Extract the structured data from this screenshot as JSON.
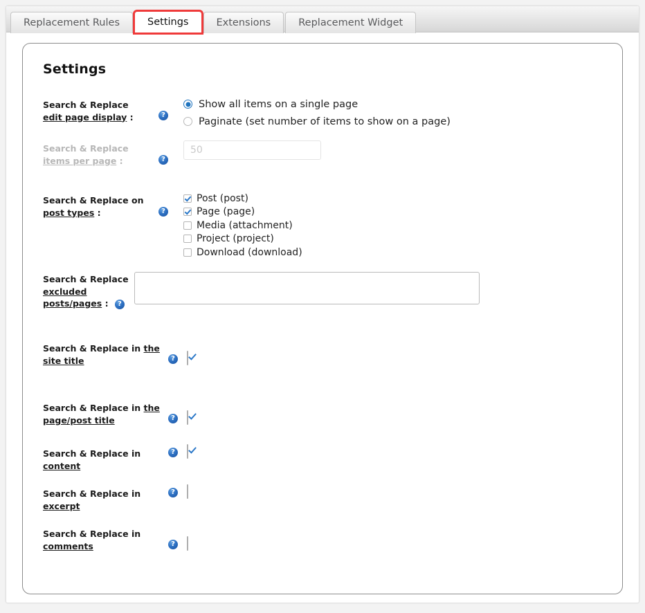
{
  "tabs": [
    {
      "label": "Replacement Rules",
      "active": false
    },
    {
      "label": "Settings",
      "active": true
    },
    {
      "label": "Extensions",
      "active": false
    },
    {
      "label": "Replacement Widget",
      "active": false
    }
  ],
  "panel": {
    "title": "Settings"
  },
  "icons": {
    "help": "?"
  },
  "colors": {
    "accent_blue": "#1e73be",
    "check_blue": "#2b78c8",
    "highlight_red": "#ef3a3a",
    "disabled_grey": "#b7b7b7"
  },
  "rows": {
    "edit_page_display": {
      "label_prefix": "Search & Replace",
      "label_link": "edit page display",
      "label_suffix": " :",
      "options": [
        {
          "label": "Show all items on a single page",
          "checked": true
        },
        {
          "label": "Paginate (set number of items to show on a page)",
          "checked": false
        }
      ]
    },
    "items_per_page": {
      "label_prefix": "Search & Replace",
      "label_link": "items per page",
      "label_suffix": " :",
      "placeholder": "50",
      "value": "",
      "disabled": true
    },
    "post_types": {
      "label_prefix": "Search & Replace on",
      "label_link": "post types",
      "label_suffix": " :",
      "options": [
        {
          "label": "Post (post)",
          "checked": true
        },
        {
          "label": "Page (page)",
          "checked": true
        },
        {
          "label": "Media (attachment)",
          "checked": false
        },
        {
          "label": "Project (project)",
          "checked": false
        },
        {
          "label": "Download (download)",
          "checked": false
        }
      ]
    },
    "excluded": {
      "label_prefix": "Search & Replace",
      "label_link": "excluded posts/pages",
      "label_suffix": " :",
      "value": ""
    },
    "site_title": {
      "label_prefix": "Search & Replace in ",
      "label_link": "the site title",
      "checked": true
    },
    "page_post_title": {
      "label_prefix": "Search & Replace in ",
      "label_link": "the page/post title",
      "checked": true
    },
    "content": {
      "label_prefix": "Search & Replace in ",
      "label_link": "content",
      "checked": true
    },
    "excerpt": {
      "label_prefix": "Search & Replace in ",
      "label_link": "excerpt",
      "checked": false
    },
    "comments": {
      "label_prefix": "Search & Replace in ",
      "label_link": "comments",
      "checked": false
    }
  }
}
